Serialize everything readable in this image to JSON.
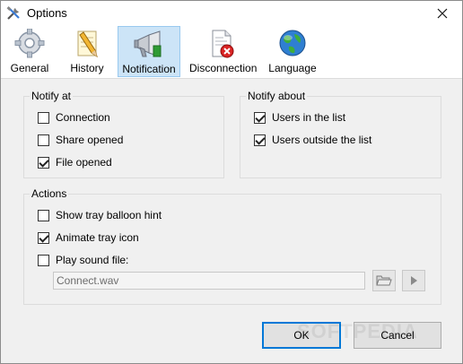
{
  "window": {
    "title": "Options",
    "close_glyph": "✕"
  },
  "tabs": [
    {
      "label": "General",
      "icon": "gear-icon"
    },
    {
      "label": "History",
      "icon": "pencil-paper-icon"
    },
    {
      "label": "Notification",
      "icon": "megaphone-icon",
      "active": true
    },
    {
      "label": "Disconnection",
      "icon": "document-error-icon"
    },
    {
      "label": "Language",
      "icon": "globe-icon"
    }
  ],
  "notify_at": {
    "title": "Notify at",
    "items": [
      {
        "label": "Connection",
        "checked": false
      },
      {
        "label": "Share opened",
        "checked": false
      },
      {
        "label": "File opened",
        "checked": true
      }
    ]
  },
  "notify_about": {
    "title": "Notify about",
    "items": [
      {
        "label": "Users in the list",
        "checked": true
      },
      {
        "label": "Users outside the list",
        "checked": true
      }
    ]
  },
  "actions": {
    "title": "Actions",
    "items": [
      {
        "label": "Show tray balloon hint",
        "checked": false
      },
      {
        "label": "Animate tray icon",
        "checked": true
      },
      {
        "label": "Play sound file:",
        "checked": false
      }
    ],
    "sound_file": "Connect.wav"
  },
  "buttons": {
    "ok": "OK",
    "cancel": "Cancel"
  },
  "watermark": "SOFTPEDIA"
}
